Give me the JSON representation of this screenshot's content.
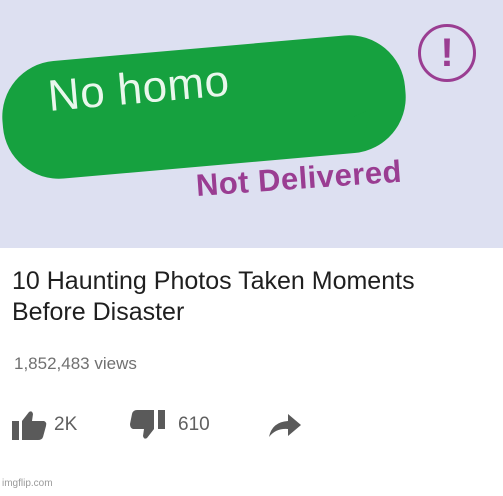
{
  "message": {
    "text": "No homo",
    "status": "Not Delivered",
    "alert_icon": "exclamation-circle-icon",
    "alert_glyph": "!",
    "bubble_color": "#16a13f",
    "status_color": "#9a3d92"
  },
  "video": {
    "title": "10 Haunting Photos Taken Moments Before Disaster",
    "views": "1,852,483 views",
    "likes": "2K",
    "dislikes": "610",
    "like_icon": "thumbs-up-icon",
    "dislike_icon": "thumbs-down-icon",
    "share_icon": "share-arrow-icon"
  },
  "watermark": "imgflip.com"
}
